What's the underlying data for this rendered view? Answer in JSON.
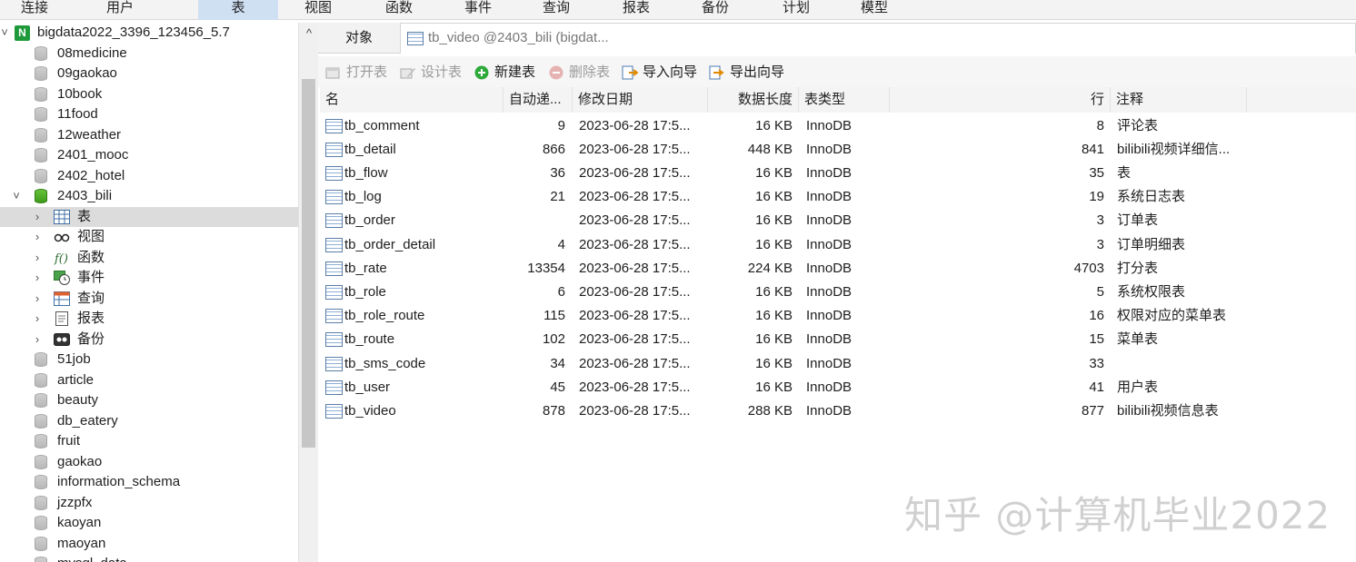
{
  "menubar": {
    "items": [
      "连接",
      "用户",
      "表",
      "视图",
      "函数",
      "事件",
      "查询",
      "报表",
      "备份",
      "计划",
      "模型"
    ],
    "active_index": 2,
    "accent": "#cfe0f3"
  },
  "tree": {
    "connection": "bigdata2022_3396_123456_5.7",
    "databases_before": [
      "08medicine",
      "09gaokao",
      "10book",
      "11food",
      "12weather",
      "2401_mooc",
      "2402_hotel"
    ],
    "open_database": "2403_bili",
    "open_children": [
      {
        "label": "表",
        "icon": "table-icon"
      },
      {
        "label": "视图",
        "icon": "view-icon"
      },
      {
        "label": "函数",
        "icon": "function-icon"
      },
      {
        "label": "事件",
        "icon": "event-icon"
      },
      {
        "label": "查询",
        "icon": "query-icon"
      },
      {
        "label": "报表",
        "icon": "report-icon"
      },
      {
        "label": "备份",
        "icon": "backup-icon"
      }
    ],
    "databases_after": [
      "51job",
      "article",
      "beauty",
      "db_eatery",
      "fruit",
      "gaokao",
      "information_schema",
      "jzzpfx",
      "kaoyan",
      "maoyan",
      "mysql_data"
    ]
  },
  "tabs": {
    "object_tab": "对象",
    "table_tab": "tb_video @2403_bili (bigdat..."
  },
  "toolbar": {
    "open_table": "打开表",
    "design_table": "设计表",
    "new_table": "新建表",
    "delete_table": "删除表",
    "import_wizard": "导入向导",
    "export_wizard": "导出向导"
  },
  "grid": {
    "headers": {
      "name": "名",
      "auto_inc": "自动递...",
      "modified": "修改日期",
      "data_len": "数据长度",
      "engine": "表类型",
      "rows": "行",
      "comment": "注释"
    },
    "rows": [
      {
        "name": "tb_comment",
        "auto_inc": "9",
        "modified": "2023-06-28 17:5...",
        "data_len": "16 KB",
        "engine": "InnoDB",
        "rows": "8",
        "comment": "评论表"
      },
      {
        "name": "tb_detail",
        "auto_inc": "866",
        "modified": "2023-06-28 17:5...",
        "data_len": "448 KB",
        "engine": "InnoDB",
        "rows": "841",
        "comment": "bilibili视频详细信..."
      },
      {
        "name": "tb_flow",
        "auto_inc": "36",
        "modified": "2023-06-28 17:5...",
        "data_len": "16 KB",
        "engine": "InnoDB",
        "rows": "35",
        "comment": "表"
      },
      {
        "name": "tb_log",
        "auto_inc": "21",
        "modified": "2023-06-28 17:5...",
        "data_len": "16 KB",
        "engine": "InnoDB",
        "rows": "19",
        "comment": "系统日志表"
      },
      {
        "name": "tb_order",
        "auto_inc": "",
        "modified": "2023-06-28 17:5...",
        "data_len": "16 KB",
        "engine": "InnoDB",
        "rows": "3",
        "comment": "订单表"
      },
      {
        "name": "tb_order_detail",
        "auto_inc": "4",
        "modified": "2023-06-28 17:5...",
        "data_len": "16 KB",
        "engine": "InnoDB",
        "rows": "3",
        "comment": "订单明细表"
      },
      {
        "name": "tb_rate",
        "auto_inc": "13354",
        "modified": "2023-06-28 17:5...",
        "data_len": "224 KB",
        "engine": "InnoDB",
        "rows": "4703",
        "comment": "打分表"
      },
      {
        "name": "tb_role",
        "auto_inc": "6",
        "modified": "2023-06-28 17:5...",
        "data_len": "16 KB",
        "engine": "InnoDB",
        "rows": "5",
        "comment": "系统权限表"
      },
      {
        "name": "tb_role_route",
        "auto_inc": "115",
        "modified": "2023-06-28 17:5...",
        "data_len": "16 KB",
        "engine": "InnoDB",
        "rows": "16",
        "comment": "权限对应的菜单表"
      },
      {
        "name": "tb_route",
        "auto_inc": "102",
        "modified": "2023-06-28 17:5...",
        "data_len": "16 KB",
        "engine": "InnoDB",
        "rows": "15",
        "comment": "菜单表"
      },
      {
        "name": "tb_sms_code",
        "auto_inc": "34",
        "modified": "2023-06-28 17:5...",
        "data_len": "16 KB",
        "engine": "InnoDB",
        "rows": "33",
        "comment": ""
      },
      {
        "name": "tb_user",
        "auto_inc": "45",
        "modified": "2023-06-28 17:5...",
        "data_len": "16 KB",
        "engine": "InnoDB",
        "rows": "41",
        "comment": "用户表"
      },
      {
        "name": "tb_video",
        "auto_inc": "878",
        "modified": "2023-06-28 17:5...",
        "data_len": "288 KB",
        "engine": "InnoDB",
        "rows": "877",
        "comment": "bilibili视频信息表"
      }
    ]
  },
  "watermark": "知乎 @计算机毕业2022"
}
